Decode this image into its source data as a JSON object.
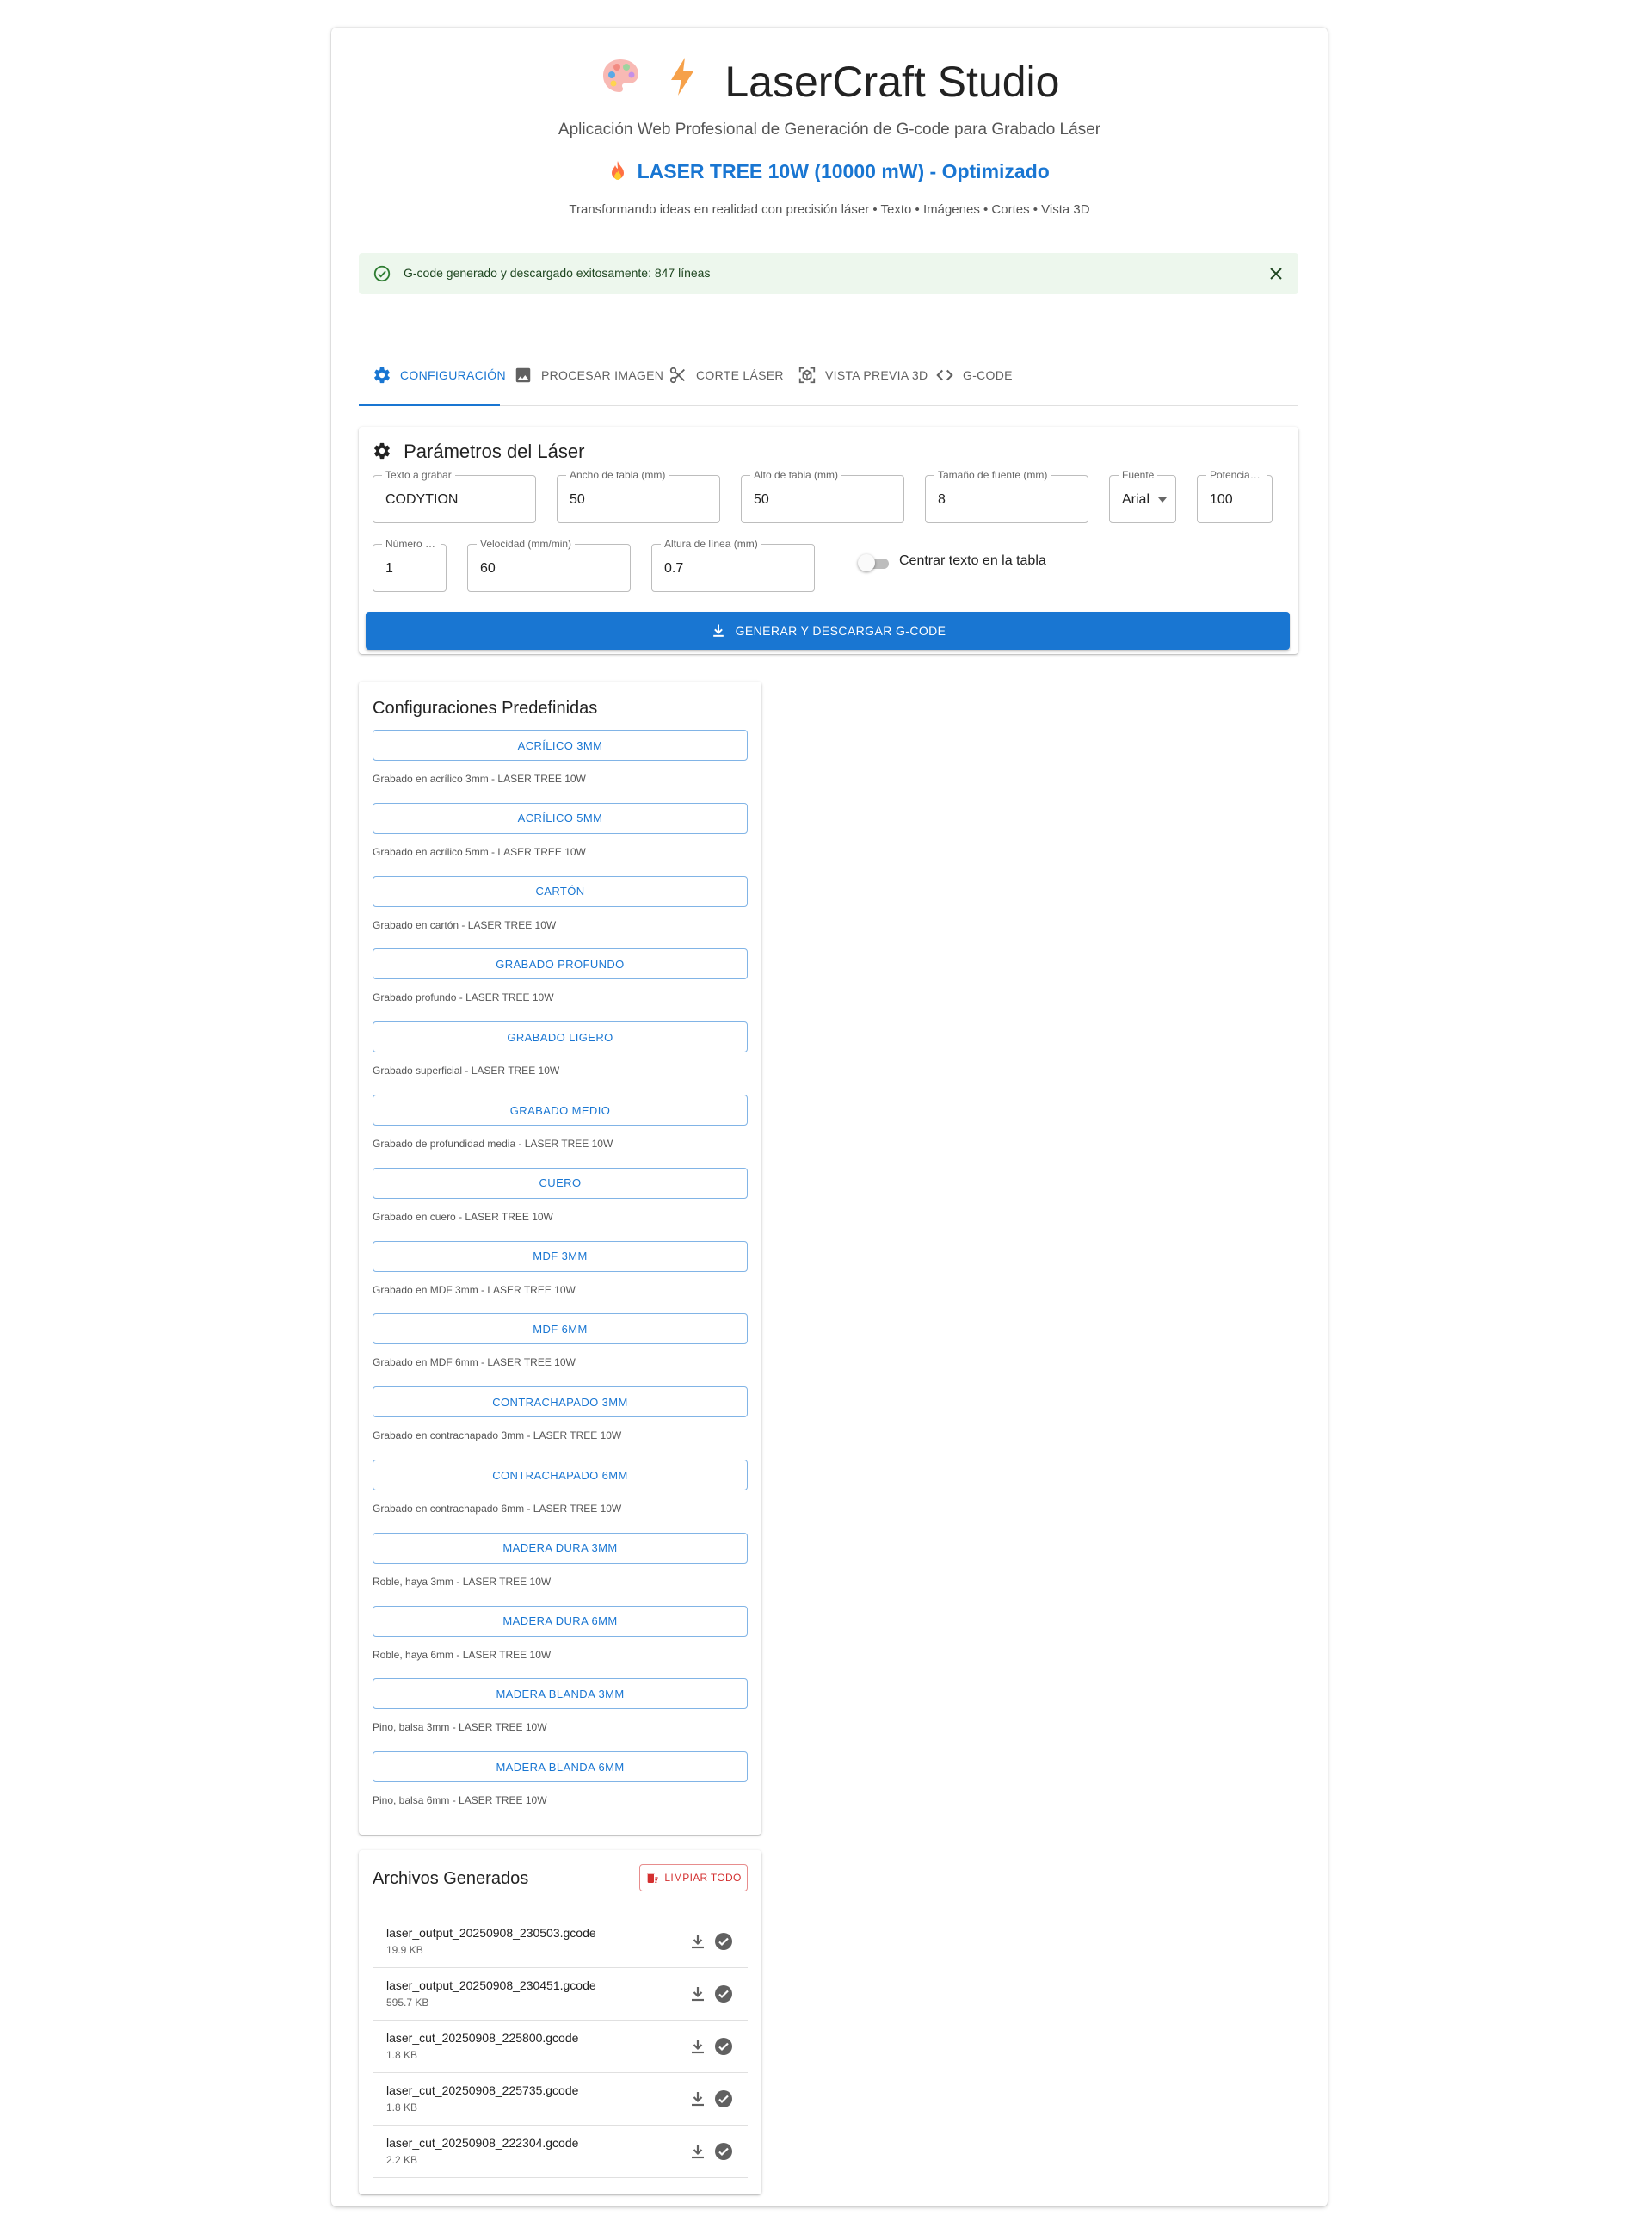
{
  "header": {
    "title": "LaserCraft Studio",
    "subtitle": "Aplicación Web Profesional de Generación de G-code para Grabado Láser",
    "model": "LASER TREE 10W (10000 mW) - Optimizado",
    "tagline": "Transformando ideas en realidad con precisión láser • Texto • Imágenes • Cortes • Vista 3D",
    "icons": [
      "palette-icon",
      "lightning-icon",
      "fire-icon"
    ]
  },
  "alert": {
    "message": "G-code generado y descargado exitosamente: 847 líneas",
    "severity": "success"
  },
  "tabs": [
    {
      "label": "CONFIGURACIÓN",
      "icon": "gear-icon",
      "active": true
    },
    {
      "label": "PROCESAR IMAGEN",
      "icon": "image-icon",
      "active": false
    },
    {
      "label": "CORTE LÁSER",
      "icon": "scissors-icon",
      "active": false
    },
    {
      "label": "VISTA PREVIA 3D",
      "icon": "3d-view-icon",
      "active": false
    },
    {
      "label": "G-CODE",
      "icon": "code-icon",
      "active": false
    }
  ],
  "laser_params": {
    "title": "Parámetros del Láser",
    "fields": {
      "text": {
        "label": "Texto a grabar",
        "value": "CODYTION"
      },
      "table_width": {
        "label": "Ancho de tabla (mm)",
        "value": "50"
      },
      "table_height": {
        "label": "Alto de tabla (mm)",
        "value": "50"
      },
      "font_size": {
        "label": "Tamaño de fuente (mm)",
        "value": "8"
      },
      "font": {
        "label": "Fuente",
        "value": "Arial"
      },
      "power": {
        "label": "Potencia m...",
        "value": "100"
      },
      "passes": {
        "label": "Número de...",
        "value": "1"
      },
      "speed": {
        "label": "Velocidad (mm/min)",
        "value": "60"
      },
      "line_height": {
        "label": "Altura de línea (mm)",
        "value": "0.7"
      }
    },
    "center_switch": {
      "label": "Centrar texto en la tabla",
      "checked": false
    },
    "generate_button": "GENERAR Y DESCARGAR G-CODE"
  },
  "presets": {
    "title": "Configuraciones Predefinidas",
    "items": [
      {
        "label": "ACRÍLICO 3MM",
        "desc": "Grabado en acrílico 3mm - LASER TREE 10W"
      },
      {
        "label": "ACRÍLICO 5MM",
        "desc": "Grabado en acrílico 5mm - LASER TREE 10W"
      },
      {
        "label": "CARTÓN",
        "desc": "Grabado en cartón - LASER TREE 10W"
      },
      {
        "label": "GRABADO PROFUNDO",
        "desc": "Grabado profundo - LASER TREE 10W"
      },
      {
        "label": "GRABADO LIGERO",
        "desc": "Grabado superficial - LASER TREE 10W"
      },
      {
        "label": "GRABADO MEDIO",
        "desc": "Grabado de profundidad media - LASER TREE 10W"
      },
      {
        "label": "CUERO",
        "desc": "Grabado en cuero - LASER TREE 10W"
      },
      {
        "label": "MDF 3MM",
        "desc": "Grabado en MDF 3mm - LASER TREE 10W"
      },
      {
        "label": "MDF 6MM",
        "desc": "Grabado en MDF 6mm - LASER TREE 10W"
      },
      {
        "label": "CONTRACHAPADO 3MM",
        "desc": "Grabado en contrachapado 3mm - LASER TREE 10W"
      },
      {
        "label": "CONTRACHAPADO 6MM",
        "desc": "Grabado en contrachapado 6mm - LASER TREE 10W"
      },
      {
        "label": "MADERA DURA 3MM",
        "desc": "Roble, haya 3mm - LASER TREE 10W"
      },
      {
        "label": "MADERA DURA 6MM",
        "desc": "Roble, haya 6mm - LASER TREE 10W"
      },
      {
        "label": "MADERA BLANDA 3MM",
        "desc": "Pino, balsa 3mm - LASER TREE 10W"
      },
      {
        "label": "MADERA BLANDA 6MM",
        "desc": "Pino, balsa 6mm - LASER TREE 10W"
      }
    ]
  },
  "files": {
    "title": "Archivos Generados",
    "clear_button": "LIMPIAR TODO",
    "items": [
      {
        "name": "laser_output_20250908_230503.gcode",
        "size": "19.9 KB"
      },
      {
        "name": "laser_output_20250908_230451.gcode",
        "size": "595.7 KB"
      },
      {
        "name": "laser_cut_20250908_225800.gcode",
        "size": "1.8 KB"
      },
      {
        "name": "laser_cut_20250908_225735.gcode",
        "size": "1.8 KB"
      },
      {
        "name": "laser_cut_20250908_222304.gcode",
        "size": "2.2 KB"
      }
    ]
  },
  "colors": {
    "primary": "#1976d2",
    "success_bg": "#edf7ed",
    "success_fg": "#2e7d32",
    "danger": "#d32f2f"
  }
}
